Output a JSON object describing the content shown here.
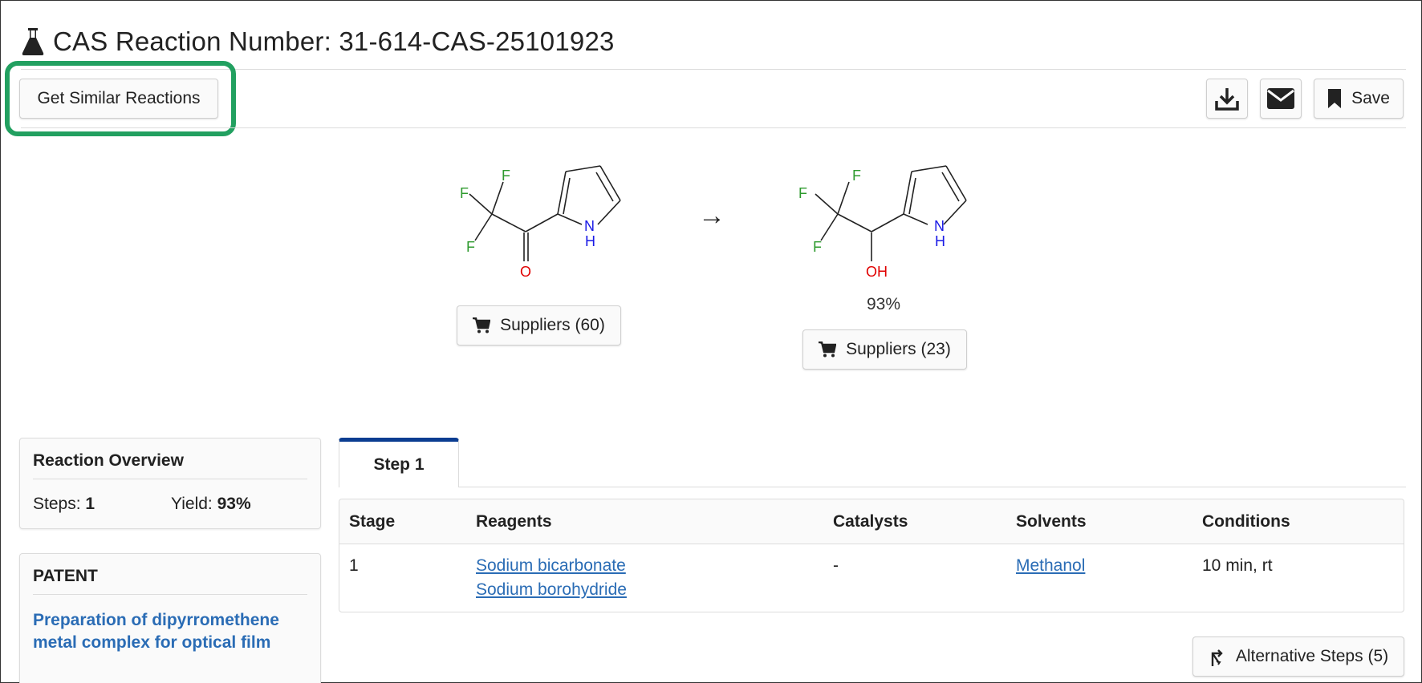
{
  "header": {
    "title": "CAS Reaction Number: 31-614-CAS-25101923",
    "icon": "flask-icon"
  },
  "toolbar": {
    "similar_label": "Get Similar Reactions",
    "save_label": "Save"
  },
  "reaction": {
    "reactant": {
      "atoms": {
        "f1": "F",
        "f2": "F",
        "f3": "F",
        "o": "O",
        "n": "N",
        "h": "H"
      },
      "suppliers_label": "Suppliers (60)"
    },
    "arrow": "→",
    "product": {
      "atoms": {
        "f1": "F",
        "f2": "F",
        "f3": "F",
        "oh": "OH",
        "n": "N",
        "h": "H"
      },
      "yield": "93%",
      "suppliers_label": "Suppliers (23)"
    }
  },
  "overview": {
    "title": "Reaction Overview",
    "steps_label": "Steps:",
    "steps_value": "1",
    "yield_label": "Yield:",
    "yield_value": "93%"
  },
  "patent": {
    "heading": "PATENT",
    "title_line1": "Preparation of dipyrromethene",
    "title_line2": "metal complex for optical film"
  },
  "steps": {
    "tab_label": "Step 1",
    "columns": [
      "Stage",
      "Reagents",
      "Catalysts",
      "Solvents",
      "Conditions"
    ],
    "rows": [
      {
        "stage": "1",
        "reagents": [
          "Sodium bicarbonate",
          "Sodium borohydride"
        ],
        "catalysts": "-",
        "solvents": "Methanol",
        "conditions": "10 min, rt"
      }
    ],
    "alt_label": "Alternative Steps (5)"
  },
  "colors": {
    "highlight": "#22a060",
    "tab_accent": "#0b3d91",
    "link": "#2a6cb5",
    "fluorine": "#2e9a2e",
    "oxygen": "#e00000",
    "nitrogen": "#1a1ae6"
  }
}
